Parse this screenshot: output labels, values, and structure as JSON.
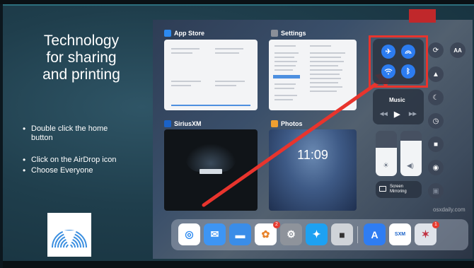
{
  "slide": {
    "title_lines": [
      "Technology",
      "for sharing",
      "and printing"
    ],
    "bullets": [
      "Double click the home button",
      "Click on the AirDrop icon",
      "Choose Everyone"
    ]
  },
  "screenshot": {
    "apps": {
      "app_store": "App Store",
      "settings": "Settings",
      "siriusxm": "SiriusXM",
      "photos": "Photos"
    },
    "photos_clock": "11:09",
    "control_center": {
      "music_label": "Music",
      "screen_mirroring_line1": "Screen",
      "screen_mirroring_line2": "Mirroring"
    },
    "watermark": "osxdaily.com",
    "dock_badges": {
      "photos": "2",
      "last": "1"
    }
  },
  "colors": {
    "accent_red": "#e8342d",
    "airdrop_blue": "#2c7cf0",
    "slide_bg": "#1f3e4c"
  },
  "icons": [
    "airdrop-logo-icon",
    "airplane-icon",
    "airdrop-icon",
    "wifi-icon",
    "bluetooth-icon",
    "rotation-lock-icon",
    "text-size-icon",
    "notification-icon",
    "moon-icon",
    "timer-icon",
    "camera-icon",
    "record-icon",
    "lock-icon",
    "screen-mirroring-icon",
    "brightness-icon",
    "volume-icon",
    "safari-icon",
    "mail-icon",
    "files-icon",
    "photos-icon",
    "settings-icon",
    "twitter-icon",
    "camera-app-icon",
    "appstore-icon",
    "siriusxm-icon",
    "game-icon"
  ]
}
